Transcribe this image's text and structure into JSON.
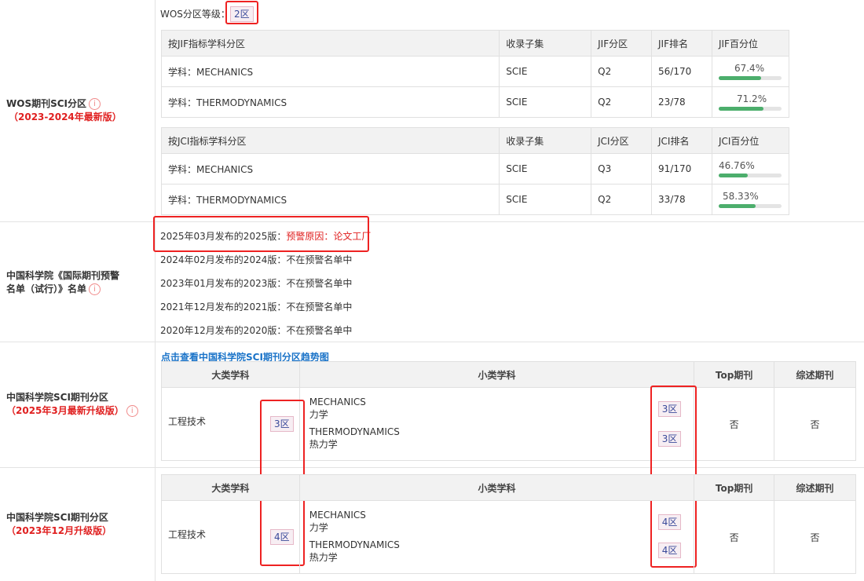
{
  "wos": {
    "label": "WOS期刊SCI分区",
    "edition": "（2023-2024年最新版）",
    "level_label": "WOS分区等级：",
    "level_value": "2区",
    "jif_headers": [
      "按JIF指标学科分区",
      "收录子集",
      "JIF分区",
      "JIF排名",
      "JIF百分位"
    ],
    "jif_rows": [
      {
        "subject": "学科：MECHANICS",
        "subset": "SCIE",
        "quartile": "Q2",
        "rank": "56/170",
        "pct": "67.4%",
        "pct_value": 67.4
      },
      {
        "subject": "学科：THERMODYNAMICS",
        "subset": "SCIE",
        "quartile": "Q2",
        "rank": "23/78",
        "pct": "71.2%",
        "pct_value": 71.2
      }
    ],
    "jci_headers": [
      "按JCI指标学科分区",
      "收录子集",
      "JCI分区",
      "JCI排名",
      "JCI百分位"
    ],
    "jci_rows": [
      {
        "subject": "学科：MECHANICS",
        "subset": "SCIE",
        "quartile": "Q3",
        "rank": "91/170",
        "pct": "46.76%",
        "pct_value": 46.76
      },
      {
        "subject": "学科：THERMODYNAMICS",
        "subset": "SCIE",
        "quartile": "Q2",
        "rank": "33/78",
        "pct": "58.33%",
        "pct_value": 58.33
      }
    ]
  },
  "warning": {
    "label": "中国科学院《国际期刊预警名单（试行）》名单",
    "lines": [
      {
        "prefix": "2025年03月发布的2025版：",
        "reason": "预警原因：论文工厂"
      },
      {
        "prefix": "2024年02月发布的2024版：不在预警名单中",
        "reason": ""
      },
      {
        "prefix": "2023年01月发布的2023版：不在预警名单中",
        "reason": ""
      },
      {
        "prefix": "2021年12月发布的2021版：不在预警名单中",
        "reason": ""
      },
      {
        "prefix": "2020年12月发布的2020版：不在预警名单中",
        "reason": ""
      }
    ]
  },
  "cas_link": "点击查看中国科学院SCI期刊分区趋势图",
  "cas2025": {
    "label": "中国科学院SCI期刊分区",
    "edition": "（2025年3月最新升级版）",
    "headers": [
      "大类学科",
      "小类学科",
      "Top期刊",
      "综述期刊"
    ],
    "major": "工程技术",
    "major_zone": "3区",
    "subs": [
      {
        "en": "MECHANICS",
        "cn": "力学",
        "zone": "3区"
      },
      {
        "en": "THERMODYNAMICS",
        "cn": "热力学",
        "zone": "3区"
      }
    ],
    "top": "否",
    "review": "否"
  },
  "cas2023": {
    "label": "中国科学院SCI期刊分区",
    "edition": "（2023年12月升级版）",
    "headers": [
      "大类学科",
      "小类学科",
      "Top期刊",
      "综述期刊"
    ],
    "major": "工程技术",
    "major_zone": "4区",
    "subs": [
      {
        "en": "MECHANICS",
        "cn": "力学",
        "zone": "4区"
      },
      {
        "en": "THERMODYNAMICS",
        "cn": "热力学",
        "zone": "4区"
      }
    ],
    "top": "否",
    "review": "否"
  },
  "icons": {
    "info": "info-circle-icon"
  },
  "colors": {
    "accent_red": "#e02020",
    "link_blue": "#1a73c8",
    "bar_green": "#4cae6c"
  }
}
